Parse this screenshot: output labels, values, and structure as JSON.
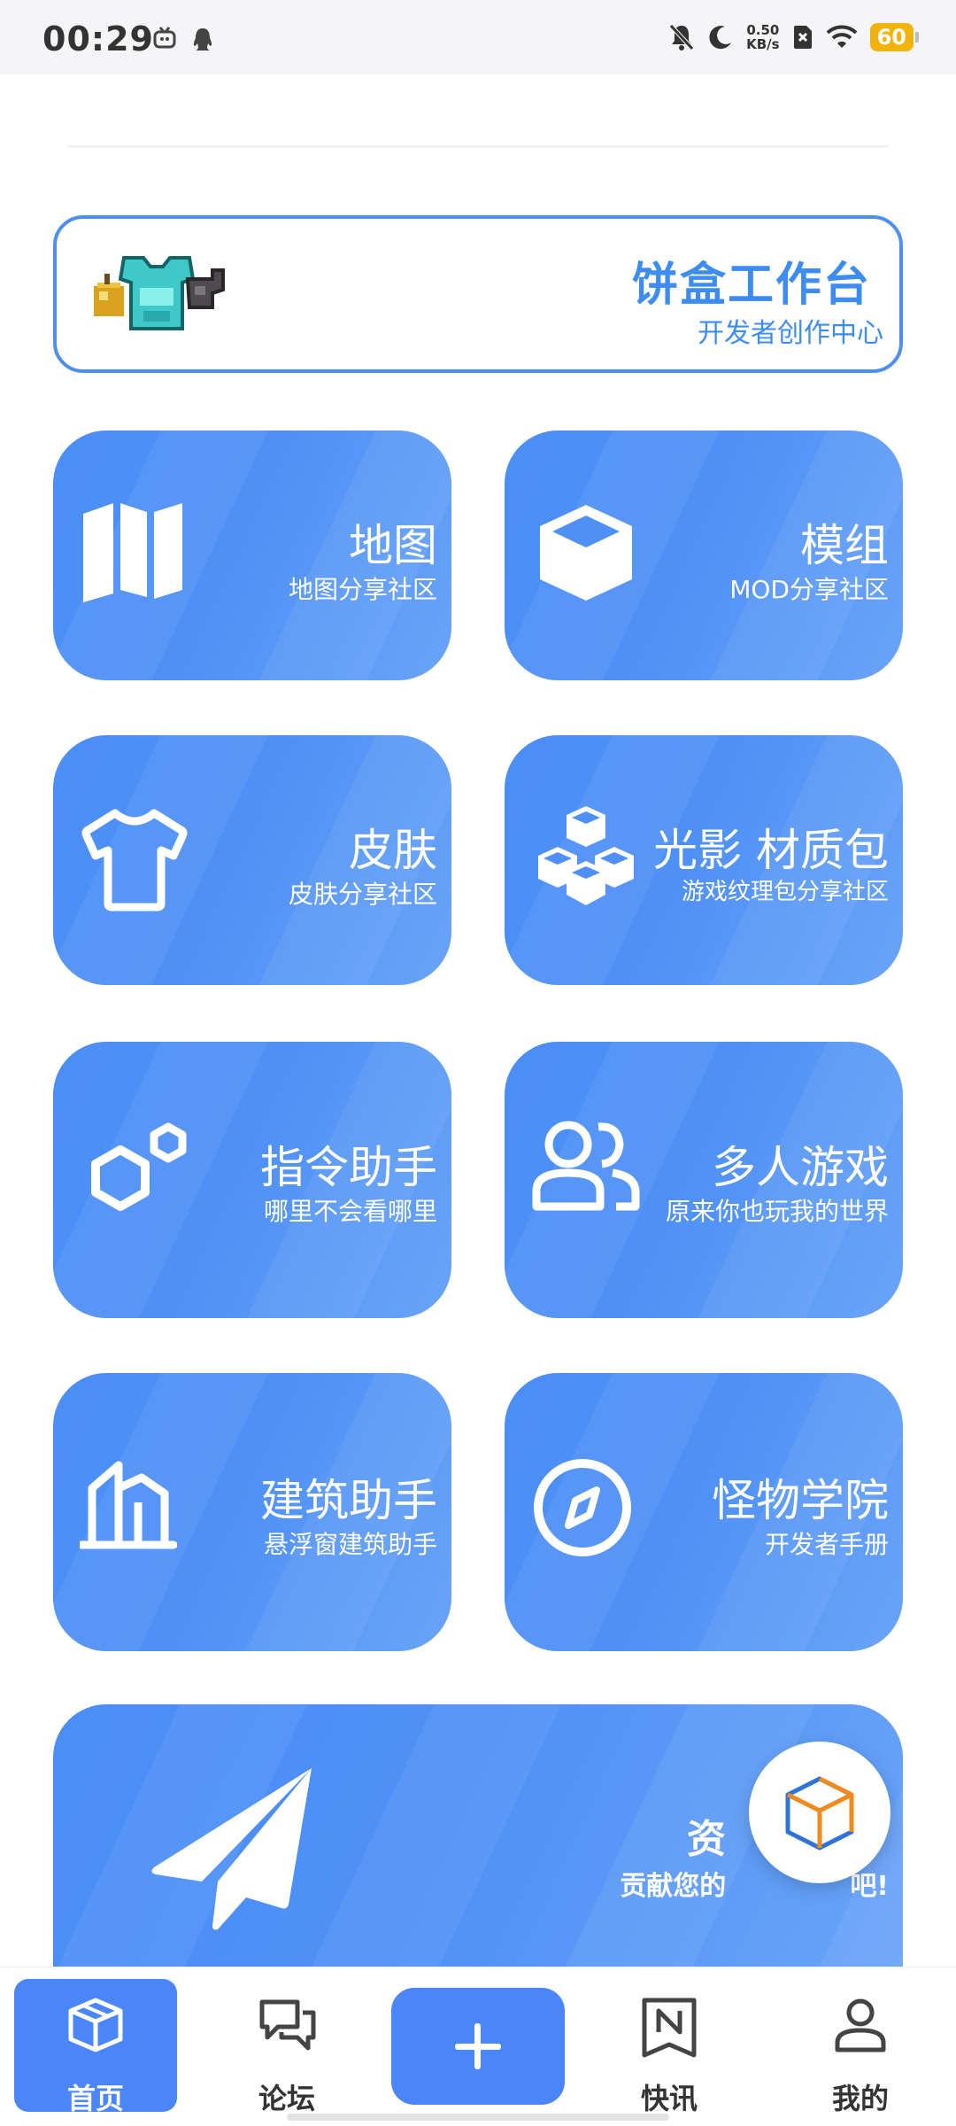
{
  "status_bar": {
    "time": "00:29",
    "net_speed_value": "0.50",
    "net_speed_unit": "KB/s",
    "battery": "60"
  },
  "workbench": {
    "title": "饼盒工作台",
    "subtitle": "开发者创作中心"
  },
  "cards": [
    {
      "title": "地图",
      "subtitle": "地图分享社区",
      "icon": "map-icon"
    },
    {
      "title": "模组",
      "subtitle": "MOD分享社区",
      "icon": "cube-icon"
    },
    {
      "title": "皮肤",
      "subtitle": "皮肤分享社区",
      "icon": "shirt-icon"
    },
    {
      "title": "光影 材质包",
      "subtitle": "游戏纹理包分享社区",
      "icon": "blocks-icon"
    },
    {
      "title": "指令助手",
      "subtitle": "哪里不会看哪里",
      "icon": "hexagon-icon"
    },
    {
      "title": "多人游戏",
      "subtitle": "原来你也玩我的世界",
      "icon": "users-icon"
    },
    {
      "title": "建筑助手",
      "subtitle": "悬浮窗建筑助手",
      "icon": "building-icon"
    },
    {
      "title": "怪物学院",
      "subtitle": "开发者手册",
      "icon": "compass-icon"
    }
  ],
  "banner": {
    "title": "资",
    "subtitle": "贡献您的",
    "subtitle_end": "吧!",
    "icon": "paper-plane-icon"
  },
  "tabs": [
    {
      "label": "首页",
      "icon": "box-icon",
      "active": true
    },
    {
      "label": "论坛",
      "icon": "chat-icon",
      "active": false
    },
    {
      "label": "快讯",
      "icon": "news-icon",
      "active": false
    },
    {
      "label": "我的",
      "icon": "person-icon",
      "active": false
    }
  ],
  "colors": {
    "accent": "#4a86f7",
    "card_gradient_start": "#4b8ef6",
    "card_gradient_end": "#6aa4f8",
    "workbench_blue": "#3d8cf0"
  }
}
